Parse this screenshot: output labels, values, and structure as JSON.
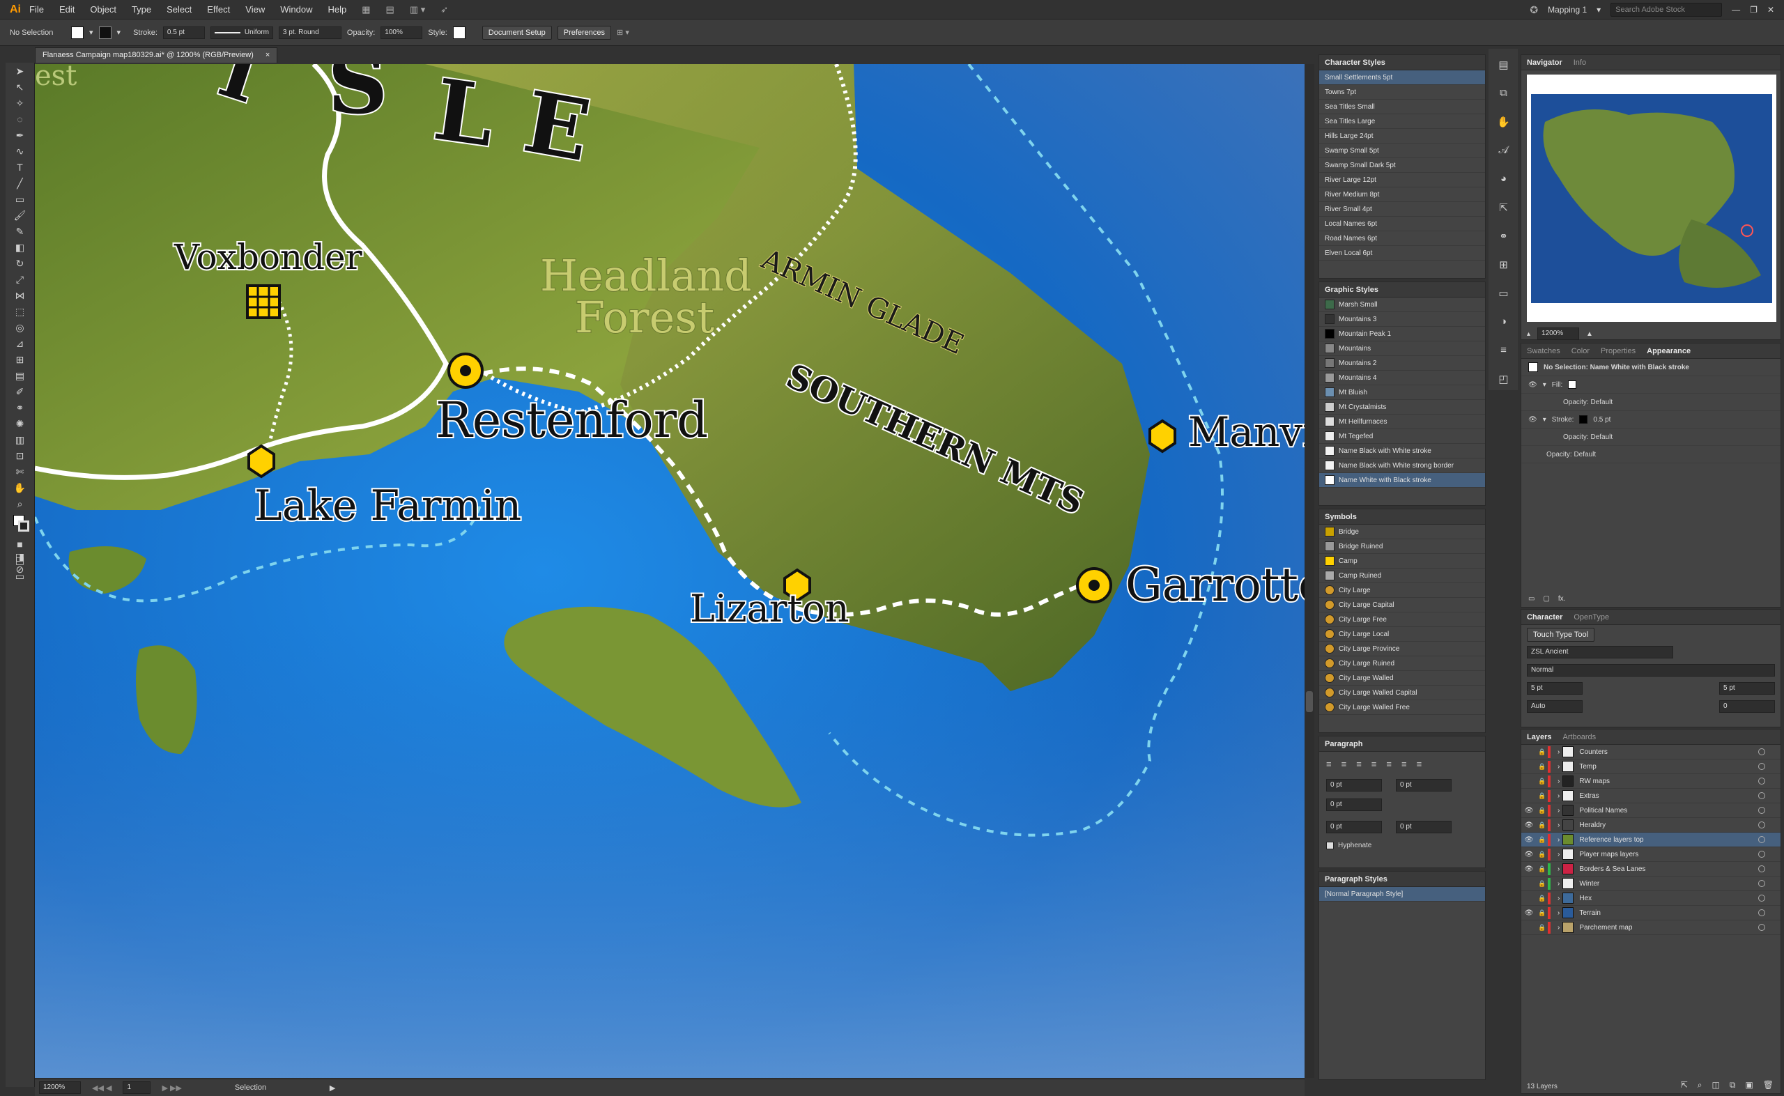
{
  "app": {
    "logo": "Ai",
    "menus": [
      "File",
      "Edit",
      "Object",
      "Type",
      "Select",
      "Effect",
      "View",
      "Window",
      "Help"
    ],
    "workspace": "Mapping 1",
    "search_placeholder": "Search Adobe Stock"
  },
  "control": {
    "selection": "No Selection",
    "stroke_label": "Stroke:",
    "stroke_value": "0.5 pt",
    "uniform": "Uniform",
    "brush": "3 pt. Round",
    "opacity_label": "Opacity:",
    "opacity_value": "100%",
    "style_label": "Style:",
    "doc_setup": "Document Setup",
    "preferences": "Preferences"
  },
  "document": {
    "tab_title": "Flanaess Campaign map180329.ai* @ 1200% (RGB/Preview)",
    "close": "×"
  },
  "map": {
    "labels": {
      "isle_i": "I",
      "isle_s": "S",
      "isle_l": "L",
      "isle_e": "E",
      "est": "est",
      "voxbonder": "Voxbonder",
      "headland1": "Headland",
      "headland2": "Forest",
      "armin": "ARMIN GLADE",
      "southern": "SOUTHERN MTS",
      "restenford": "Restenford",
      "lake_farmin": "Lake Farmin",
      "manvil": "Manvil",
      "lizarton": "Lizarton",
      "garrotte": "Garrotte"
    },
    "colors": {
      "ocean": "#1f70c8",
      "land": "#6d8a2e",
      "settlement": "#ffd100"
    }
  },
  "status": {
    "zoom": "1200%",
    "page": "1",
    "tool": "Selection"
  },
  "character_styles": {
    "title": "Character Styles",
    "items": [
      "Small Settlements 5pt",
      "Towns 7pt",
      "Sea Titles Small",
      "Sea Titles Large",
      "Hills Large 24pt",
      "Swamp Small 5pt",
      "Swamp Small Dark 5pt",
      "River Large 12pt",
      "River Medium 8pt",
      "River Small 4pt",
      "Local Names 6pt",
      "Road Names 6pt",
      "Elven Local 6pt"
    ]
  },
  "graphic_styles": {
    "title": "Graphic Styles",
    "items": [
      "Marsh Small",
      "Mountains 3",
      "Mountain Peak 1",
      "Mountains",
      "Mountains 2",
      "Mountains 4",
      "Mt Bluish",
      "Mt Crystalmists",
      "Mt Hellfurnaces",
      "Mt Tegefed",
      "Name Black with White stroke",
      "Name Black with White strong border",
      "Name White with Black stroke"
    ]
  },
  "symbols": {
    "title": "Symbols",
    "items": [
      "Bridge",
      "Bridge Ruined",
      "Camp",
      "Camp Ruined",
      "City Large",
      "City Large Capital",
      "City Large Free",
      "City Large Local",
      "City Large Province",
      "City Large Ruined",
      "City Large Walled",
      "City Large Walled Capital",
      "City Large Walled Free"
    ]
  },
  "paragraph": {
    "title": "Paragraph",
    "v1": "0 pt",
    "v2": "0 pt",
    "v3": "0 pt",
    "v4": "0 pt",
    "v5": "0 pt",
    "hyphenate": "Hyphenate"
  },
  "paragraph_styles": {
    "title": "Paragraph Styles",
    "items": [
      "[Normal Paragraph Style]"
    ]
  },
  "navigator": {
    "tab": "Navigator",
    "tab2": "Info",
    "zoom": "1200%"
  },
  "appearance": {
    "tabs": [
      "Swatches",
      "Color",
      "Properties",
      "Appearance"
    ],
    "header": "No Selection: Name White with Black stroke",
    "fill": "Fill:",
    "opacity1": "Opacity: Default",
    "stroke": "Stroke:",
    "stroke_val": "0.5 pt",
    "opacity2": "Opacity: Default",
    "opacity3": "Opacity: Default",
    "fx": "fx."
  },
  "character": {
    "tab": "Character",
    "tab2": "OpenType",
    "touch": "Touch Type Tool",
    "font": "ZSL Ancient",
    "style": "Normal",
    "size": "5 pt",
    "leading": "Auto",
    "kern": "5 pt",
    "track": "0"
  },
  "layers": {
    "tab": "Layers",
    "tab2": "Artboards",
    "count": "13 Layers",
    "items": [
      {
        "name": "Counters",
        "color": "#e03030",
        "visible": false
      },
      {
        "name": "Temp",
        "color": "#e03030",
        "visible": false
      },
      {
        "name": "RW maps",
        "color": "#e03030",
        "visible": false
      },
      {
        "name": "Extras",
        "color": "#e03030",
        "visible": false
      },
      {
        "name": "Political Names",
        "color": "#e03030",
        "visible": true
      },
      {
        "name": "Heraldry",
        "color": "#e03030",
        "visible": true
      },
      {
        "name": "Reference layers top",
        "color": "#e03030",
        "visible": true
      },
      {
        "name": "Player maps layers",
        "color": "#e03030",
        "visible": true
      },
      {
        "name": "Borders & Sea Lanes",
        "color": "#2fb84a",
        "visible": true
      },
      {
        "name": "Winter",
        "color": "#2fb84a",
        "visible": false
      },
      {
        "name": "Hex",
        "color": "#e03030",
        "visible": false
      },
      {
        "name": "Terrain",
        "color": "#e03030",
        "visible": true
      },
      {
        "name": "Parchement map",
        "color": "#e03030",
        "visible": false
      }
    ]
  }
}
